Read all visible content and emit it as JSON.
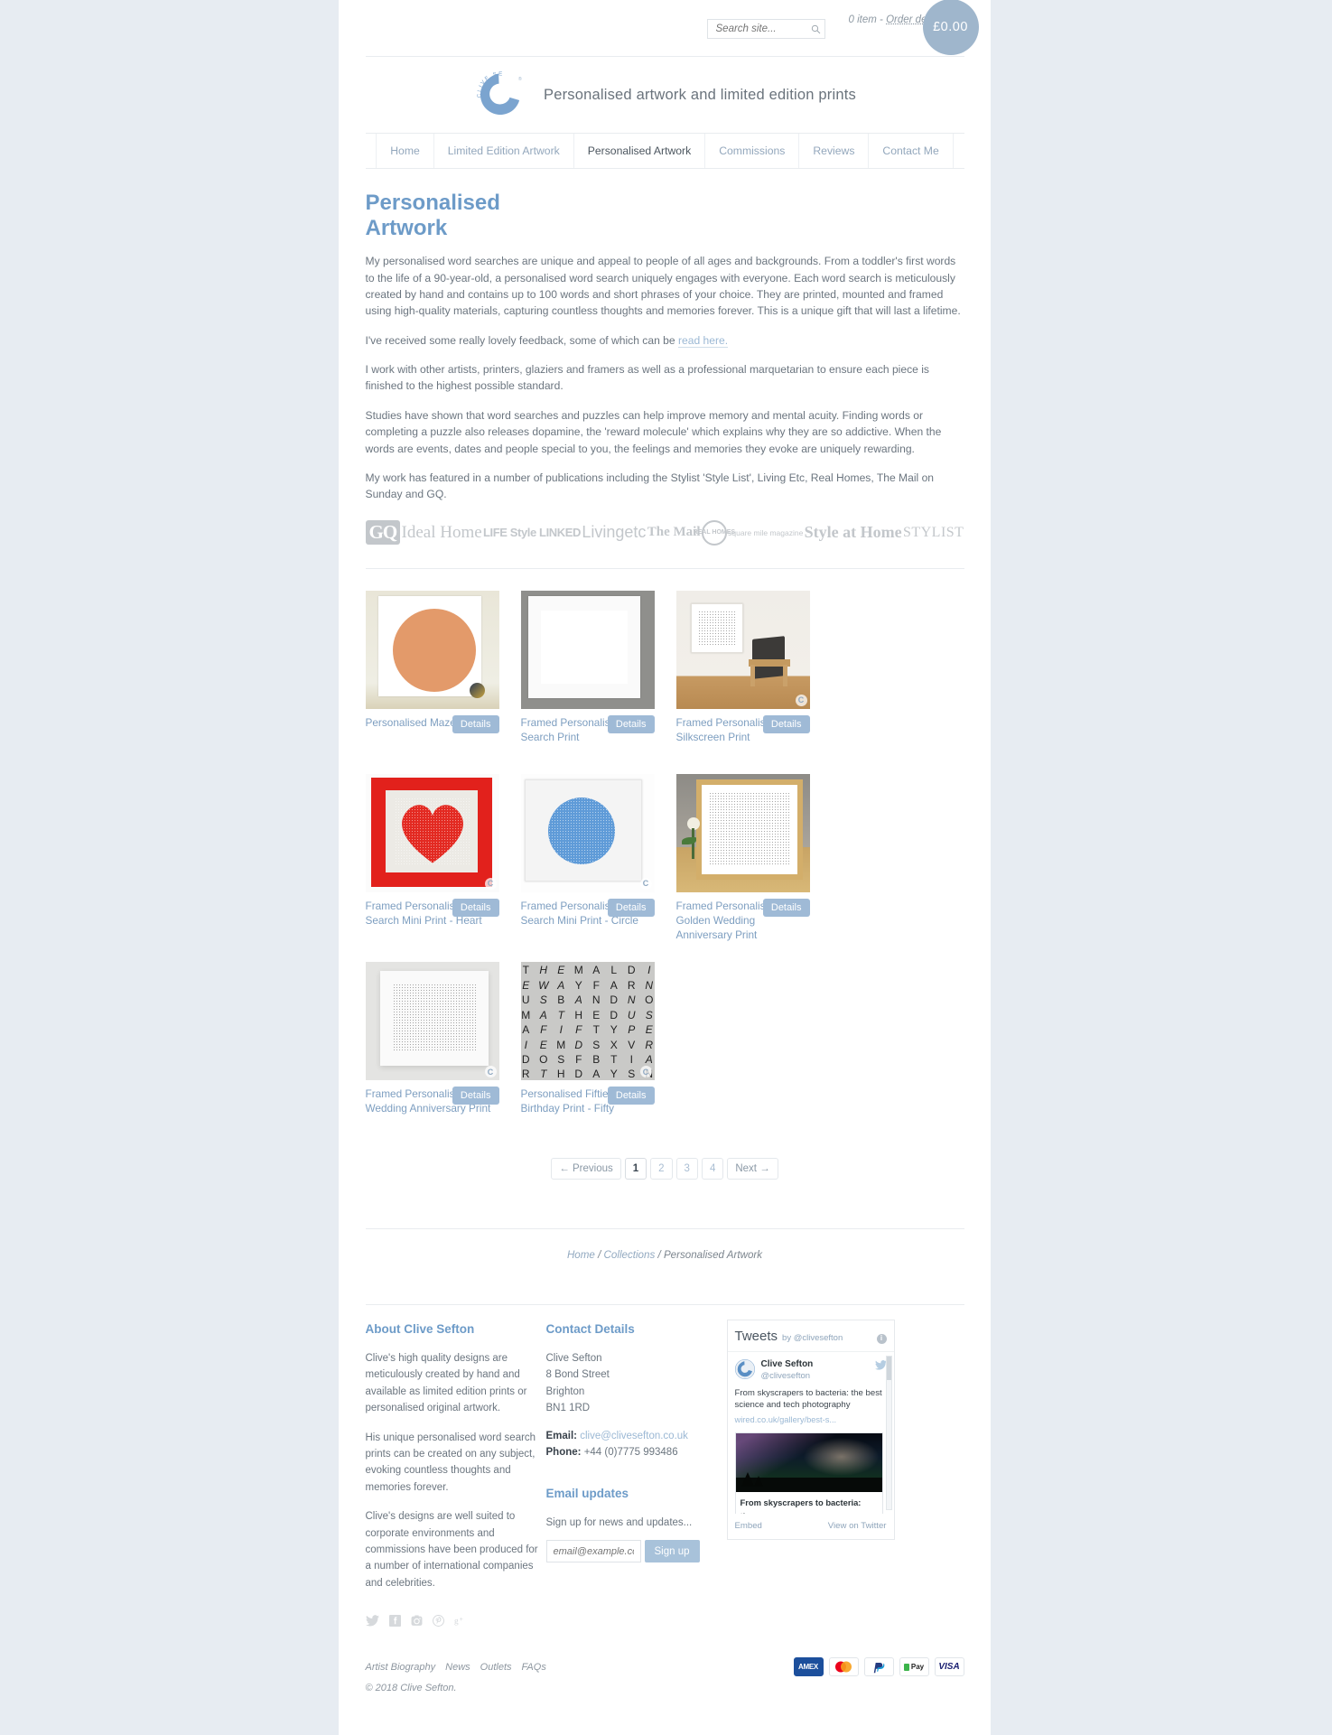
{
  "topbar": {
    "search_placeholder": "Search site...",
    "search_value": "",
    "search_icon": "search-icon",
    "cart_items": "0 item",
    "cart_sep": "-",
    "order_details": "Order details",
    "cart_total": "£0.00"
  },
  "brand": {
    "logo_text": "CLIVE SEFTON",
    "tagline": "Personalised artwork and limited edition prints"
  },
  "nav": {
    "items": [
      {
        "label": "Home",
        "active": false
      },
      {
        "label": "Limited Edition Artwork",
        "active": false
      },
      {
        "label": "Personalised Artwork",
        "active": true
      },
      {
        "label": "Commissions",
        "active": false
      },
      {
        "label": "Reviews",
        "active": false
      },
      {
        "label": "Contact Me",
        "active": false
      }
    ]
  },
  "main": {
    "title": "Personalised Artwork",
    "paragraphs": [
      "My personalised word searches are unique and appeal to people of all ages and backgrounds. From a toddler's first words to the life of a 90-year-old, a personalised word search uniquely engages with everyone. Each word search is meticulously created by hand and contains up to 100 words and short phrases of your choice. They are printed, mounted and framed using high-quality materials, capturing countless thoughts and memories forever. This is a unique gift that will last a lifetime.",
      "I work with other artists, printers, glaziers and framers as well as a professional marquetarian to ensure each piece is finished to the highest possible standard.",
      "Studies have shown that word searches and puzzles can help improve memory and mental acuity. Finding words or completing a puzzle also releases dopamine, the 'reward molecule' which explains why they are so addictive. When the words are events, dates and people special to you, the feelings and memories they evoke are uniquely rewarding.",
      "My work has featured in a number of publications including the Stylist 'Style List', Living Etc, Real Homes, The Mail on Sunday and GQ."
    ],
    "feedback_prefix": "I've received some really lovely feedback, some of which can be ",
    "feedback_link": "read here."
  },
  "press_logos": [
    {
      "name": "GQ",
      "key": "gq"
    },
    {
      "name": "Ideal Home",
      "key": "ideal"
    },
    {
      "name": "LIFE Style LINKED",
      "key": "life"
    },
    {
      "name": "Livingetc",
      "key": "living"
    },
    {
      "name": "The Mail",
      "key": "mail"
    },
    {
      "name": "REAL HOMES",
      "key": "real"
    },
    {
      "name": "square mile magazine",
      "key": "square"
    },
    {
      "name": "Style at Home",
      "key": "style"
    },
    {
      "name": "STYLIST",
      "key": "stylist"
    }
  ],
  "products": [
    {
      "title": "Personalised Maze Print",
      "button": "Details",
      "art": "maze"
    },
    {
      "title": "Framed Personalised Word Search Print",
      "button": "Details",
      "art": "grid-grey"
    },
    {
      "title": "Framed Personalised Silkscreen Print",
      "button": "Details",
      "art": "room-chair"
    },
    {
      "title": "Framed Personalised Word Search Mini Print - Heart",
      "button": "Details",
      "art": "heart-red"
    },
    {
      "title": "Framed Personalised Word Search Mini Print - Circle",
      "button": "Details",
      "art": "circle-blue"
    },
    {
      "title": "Framed Personalised Golden Wedding Anniversary Print",
      "button": "Details",
      "art": "gold-frame"
    },
    {
      "title": "Framed Personalised Silver Wedding Anniversary Print",
      "button": "Details",
      "art": "silver-frame"
    },
    {
      "title": "Personalised Fiftieth Birthday Print - Fifty",
      "button": "Details",
      "art": "letters"
    }
  ],
  "letter_art": [
    [
      "T",
      "H",
      "E",
      "M",
      "A",
      "L",
      "D",
      "I"
    ],
    [
      "E",
      "W",
      "A",
      "Y",
      "F",
      "A",
      "R",
      "N"
    ],
    [
      "U",
      "S",
      "B",
      "A",
      "N",
      "D",
      "N",
      "O"
    ],
    [
      "M",
      "A",
      "T",
      "H",
      "E",
      "D",
      "U",
      "S"
    ],
    [
      "A",
      "F",
      "I",
      "F",
      "T",
      "Y",
      "P",
      "E"
    ],
    [
      "I",
      "E",
      "M",
      "D",
      "S",
      "X",
      "V",
      "R"
    ],
    [
      "D",
      "O",
      "S",
      "F",
      "B",
      "T",
      "I",
      "A"
    ],
    [
      "R",
      "T",
      "H",
      "D",
      "A",
      "Y",
      "S",
      "N"
    ]
  ],
  "pagination": {
    "previous": "← Previous",
    "next": "Next →",
    "pages": [
      "1",
      "2",
      "3",
      "4"
    ],
    "current": "1"
  },
  "breadcrumb": {
    "home": "Home",
    "collections": "Collections",
    "current": "Personalised Artwork",
    "sep": " / "
  },
  "footer": {
    "about": {
      "heading": "About Clive Sefton",
      "paragraphs": [
        "Clive's high quality designs are meticulously created by hand and available as limited edition prints or personalised original artwork.",
        "His unique personalised word search prints can be created on any subject, evoking countless thoughts and memories forever.",
        "Clive's designs are well suited to corporate environments and commissions have been produced for a number of international companies and celebrities."
      ]
    },
    "contact": {
      "heading": "Contact Details",
      "name": "Clive Sefton",
      "street": "8 Bond Street",
      "city": "Brighton",
      "postcode": "BN1 1RD",
      "email_label": "Email:",
      "email": "clive@clivesefton.co.uk",
      "phone_label": "Phone:",
      "phone": "+44 (0)7775 993486"
    },
    "email_updates": {
      "heading": "Email updates",
      "text": "Sign up for news and updates...",
      "placeholder": "email@example.com",
      "value": "",
      "button": "Sign up"
    },
    "socials": [
      {
        "name": "twitter-icon"
      },
      {
        "name": "facebook-icon"
      },
      {
        "name": "instagram-icon"
      },
      {
        "name": "pinterest-icon"
      },
      {
        "name": "googleplus-icon"
      }
    ],
    "twitter": {
      "heading": "Tweets",
      "by": "by @clivesefton",
      "account_name": "Clive Sefton",
      "account_handle": "@clivesefton",
      "tweet_text": "From skyscrapers to bacteria: the best science and tech photography",
      "tweet_link": "wired.co.uk/gallery/best-s...",
      "card_title": "From skyscrapers to bacteria: the...",
      "embed": "Embed",
      "view": "View on Twitter"
    },
    "bottom_links": [
      "Artist Biography",
      "News",
      "Outlets",
      "FAQs"
    ],
    "copyright": "© 2018 Clive Sefton.",
    "payments": [
      {
        "label": "AMEX",
        "key": "amex"
      },
      {
        "label": "",
        "key": "mastercard"
      },
      {
        "label": "P",
        "key": "paypal"
      },
      {
        "label": "Pay",
        "key": "applepay"
      },
      {
        "label": "VISA",
        "key": "visa"
      }
    ]
  },
  "colors": {
    "accent": "#6d9bc8",
    "button": "#9fbad6",
    "badge": "#9fb6cc",
    "text": "#6b757f"
  }
}
